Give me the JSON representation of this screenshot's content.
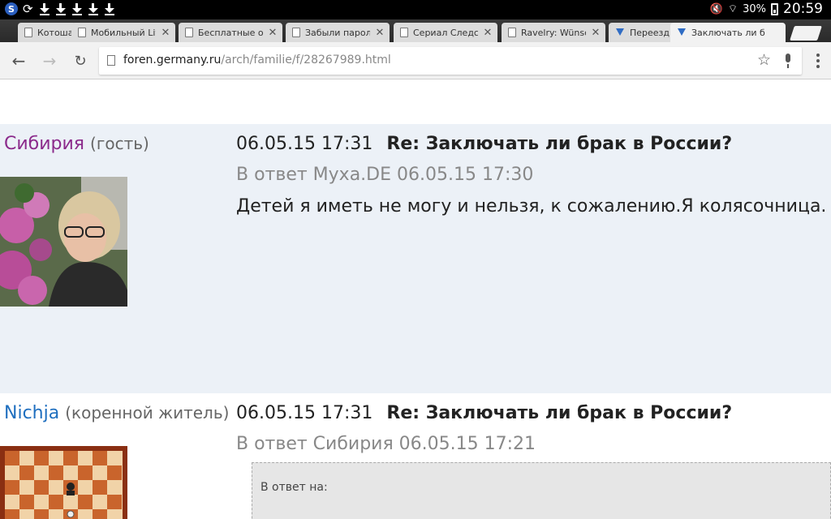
{
  "statusbar": {
    "battery": "30%",
    "time": "20:59"
  },
  "tabs": [
    {
      "title": "Котоша",
      "icon": "page-icon"
    },
    {
      "title": "Мобильный Live",
      "icon": "page-icon"
    },
    {
      "title": "Бесплатные он",
      "icon": "page-icon"
    },
    {
      "title": "Забыли пароль",
      "icon": "page-icon"
    },
    {
      "title": "Сериал Следств",
      "icon": "page-icon"
    },
    {
      "title": "Ravelry: Wünsch",
      "icon": "page-icon"
    },
    {
      "title": "Переезд",
      "icon": "forum-icon"
    },
    {
      "title": "Заключать ли б",
      "icon": "forum-icon"
    }
  ],
  "omnibox": {
    "url_host": "foren.germany.ru",
    "url_path": "/arch/familie/f/28267989.html"
  },
  "posts": [
    {
      "author": "Сибирия",
      "author_color": "#8b2a8b",
      "status": "(гость)",
      "date": "06.05.15 17:31",
      "subject": "Re: Заключать ли брак в России?",
      "reply_to": "В ответ Муха.DE 06.05.15 17:30",
      "body": "Детей я иметь не могу и нельзя, к сожалению.Я колясочница."
    },
    {
      "author": "Nichja",
      "author_color": "#1f6fbf",
      "status": "(коренной житель)",
      "date": "06.05.15 17:31",
      "subject": "Re: Заключать ли брак в России?",
      "reply_to": "В ответ Сибирия 06.05.15 17:21",
      "quote_label": "В ответ на:"
    }
  ]
}
